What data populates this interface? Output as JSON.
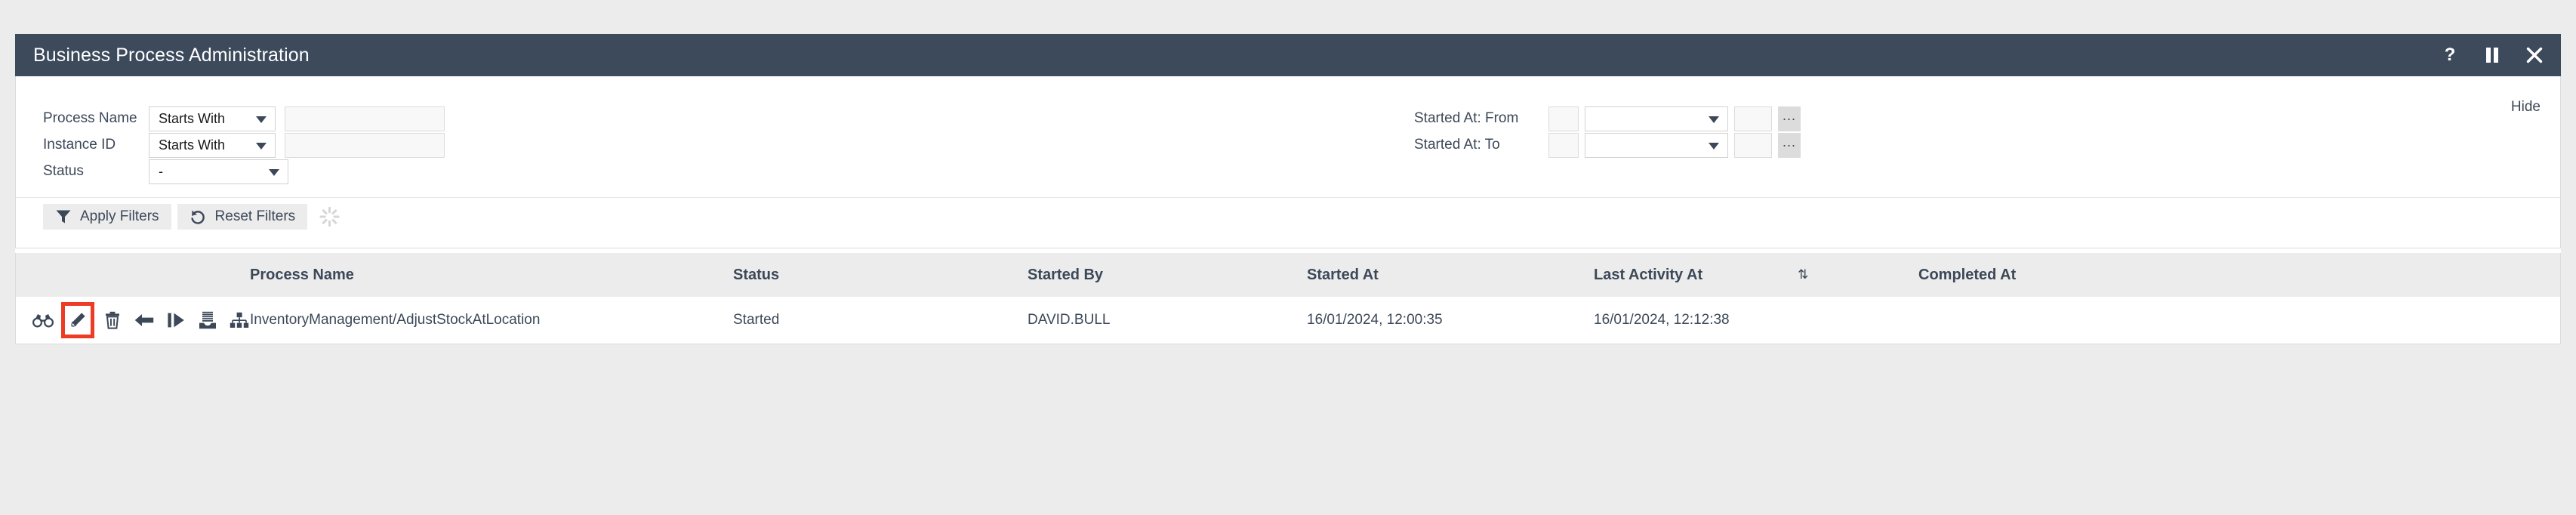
{
  "window": {
    "title": "Business Process Administration",
    "controls": [
      {
        "name": "help-button",
        "glyph": "?"
      },
      {
        "name": "pause-button",
        "glyph": "pause-icon"
      },
      {
        "name": "close-button",
        "glyph": "close-icon"
      }
    ]
  },
  "filters": {
    "hide_label": "Hide",
    "left": [
      {
        "label": "Process Name",
        "operator": "Starts With",
        "value": "",
        "placeholder": ""
      },
      {
        "label": "Instance ID",
        "operator": "Starts With",
        "value": "",
        "placeholder": ""
      },
      {
        "label": "Status",
        "operator": "-",
        "value": null,
        "placeholder": ""
      }
    ],
    "right": [
      {
        "label": "Started At: From",
        "prefix_value": "",
        "operator": "",
        "suffix_value": "",
        "picker_label": "..."
      },
      {
        "label": "Started At: To",
        "prefix_value": "",
        "operator": "",
        "suffix_value": "",
        "picker_label": "..."
      }
    ],
    "buttons": {
      "apply_label": "Apply Filters",
      "reset_label": "Reset Filters"
    }
  },
  "table": {
    "columns": [
      {
        "key": "actions",
        "label": ""
      },
      {
        "key": "process_name",
        "label": "Process Name"
      },
      {
        "key": "status",
        "label": "Status"
      },
      {
        "key": "started_by",
        "label": "Started By"
      },
      {
        "key": "started_at",
        "label": "Started At"
      },
      {
        "key": "last_activity_at",
        "label": "Last Activity At",
        "sort_indicator": "⇅"
      },
      {
        "key": "completed_at",
        "label": "Completed At"
      }
    ],
    "row_actions": [
      {
        "name": "view-icon",
        "title": "binoculars",
        "highlighted": false
      },
      {
        "name": "edit-icon",
        "title": "pencil",
        "highlighted": true
      },
      {
        "name": "delete-icon",
        "title": "trash",
        "highlighted": false
      },
      {
        "name": "back-icon",
        "title": "arrow-left",
        "highlighted": false
      },
      {
        "name": "resume-icon",
        "title": "step-forward",
        "highlighted": false
      },
      {
        "name": "archive-icon",
        "title": "stack-inbox",
        "highlighted": false
      },
      {
        "name": "hierarchy-icon",
        "title": "sitemap",
        "highlighted": false
      }
    ],
    "rows": [
      {
        "process_name": "InventoryManagement/AdjustStockAtLocation",
        "status": "Started",
        "started_by": "DAVID.BULL",
        "started_at": "16/01/2024, 12:00:35",
        "last_activity_at": "16/01/2024, 12:12:38",
        "completed_at": ""
      }
    ]
  },
  "colors": {
    "titlebar": "#3d4a5c",
    "page_background": "#ececec",
    "accent_highlight": "#ee3b24",
    "text": "#3c4858",
    "header_row": "#ececec"
  }
}
